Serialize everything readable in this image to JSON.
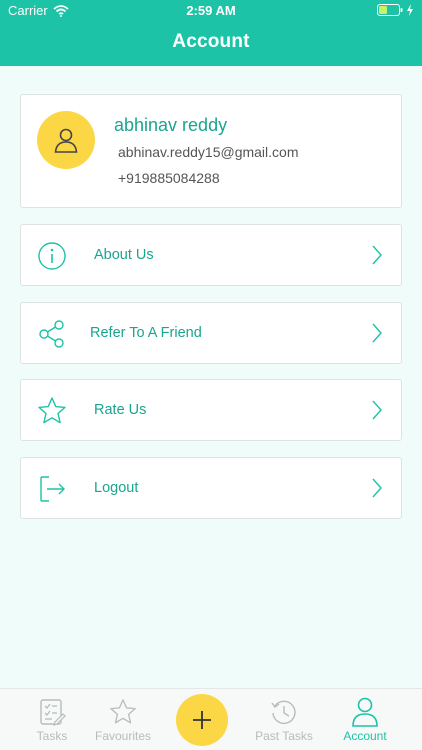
{
  "status_bar": {
    "carrier": "Carrier",
    "time": "2:59 AM"
  },
  "header": {
    "title": "Account"
  },
  "profile": {
    "name": "abhinav reddy",
    "email": "abhinav.reddy15@gmail.com",
    "phone": "+919885084288",
    "avatar_icon": "user-icon",
    "avatar_color": "#fbd746"
  },
  "menu": {
    "items": [
      {
        "label": "About Us",
        "icon": "info-icon"
      },
      {
        "label": "Refer To A Friend",
        "icon": "share-icon"
      },
      {
        "label": "Rate Us",
        "icon": "star-icon"
      },
      {
        "label": "Logout",
        "icon": "logout-icon"
      }
    ]
  },
  "tabbar": {
    "tabs": [
      {
        "label": "Tasks",
        "icon": "tasks-icon"
      },
      {
        "label": "Favourites",
        "icon": "star-icon"
      },
      {
        "label": "Past Tasks",
        "icon": "history-icon"
      },
      {
        "label": "Account",
        "icon": "user-icon",
        "active": true
      }
    ],
    "add_icon": "plus-icon"
  },
  "colors": {
    "accent": "#1cc3a6",
    "text_accent": "#1aa58f",
    "yellow": "#fbd746",
    "background": "#effcf9"
  }
}
